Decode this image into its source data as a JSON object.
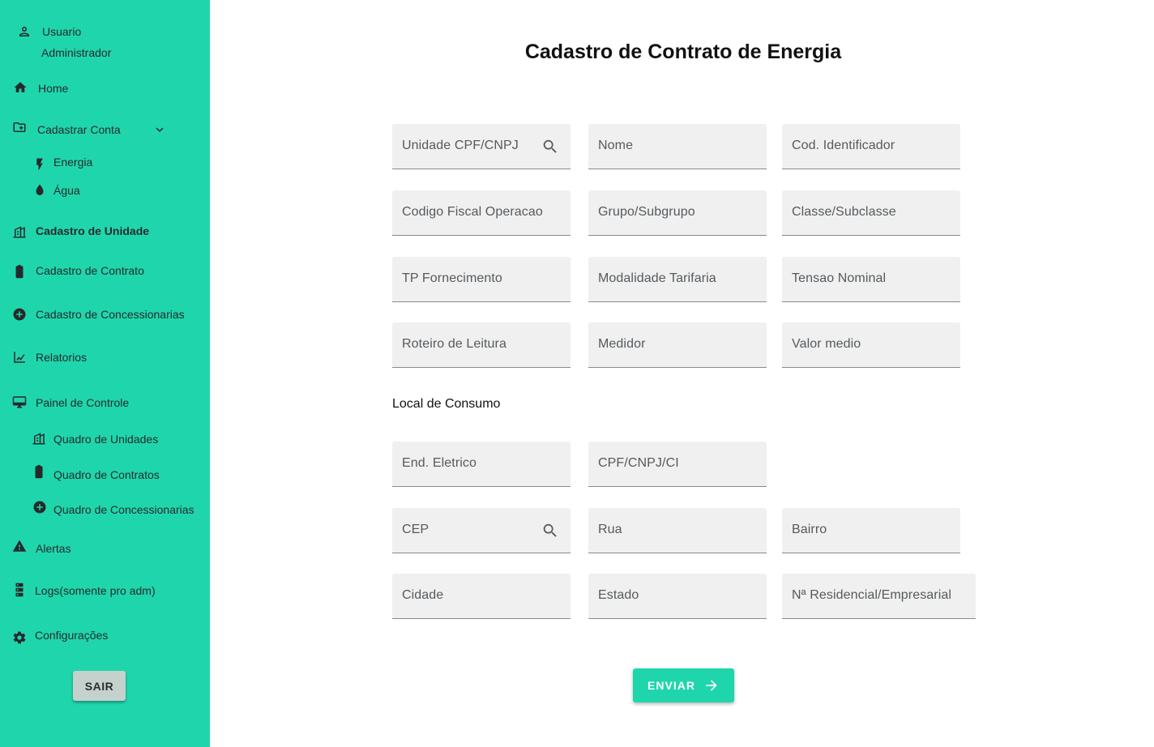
{
  "sidebar": {
    "user": {
      "name": "Usuario",
      "role": "Administrador"
    },
    "home": "Home",
    "cadastrar_conta": "Cadastrar Conta",
    "energia": "Energia",
    "agua": "Água",
    "cadastro_unidade": "Cadastro de Unidade",
    "cadastro_contrato": "Cadastro de Contrato",
    "cadastro_concessionarias": "Cadastro de Concessionarias",
    "relatorios": "Relatorios",
    "painel_controle": "Painel de Controle",
    "quadro_unidades": "Quadro de Unidades",
    "quadro_contratos": "Quadro de Contratos",
    "quadro_concessionarias": "Quadro de Concessionarias",
    "alertas": "Alertas",
    "logs": "Logs(somente pro adm)",
    "configuracoes": "Configurações",
    "sair": "SAIR"
  },
  "main": {
    "title": "Cadastro de Contrato de Energia",
    "fields": {
      "unidade": "Unidade CPF/CNPJ",
      "nome": "Nome",
      "cod_identificador": "Cod. Identificador",
      "codigo_fiscal": "Codigo Fiscal Operacao",
      "grupo": "Grupo/Subgrupo",
      "classe": "Classe/Subclasse",
      "tp_fornecimento": "TP Fornecimento",
      "modalidade": "Modalidade Tarifaria",
      "tensao": "Tensao Nominal",
      "roteiro": "Roteiro de Leitura",
      "medidor": "Medidor",
      "valor_medio": "Valor medio"
    },
    "local_section": "Local de Consumo",
    "local_fields": {
      "end_eletrico": "End. Eletrico",
      "cpf_cnpj_ci": "CPF/CNPJ/CI",
      "cep": "CEP",
      "rua": "Rua",
      "bairro": "Bairro",
      "cidade": "Cidade",
      "estado": "Estado",
      "numero": "Nª Residencial/Empresarial"
    },
    "submit": "ENVIAR"
  },
  "colors": {
    "accent": "#1fd6ac",
    "field_bg": "#f0f0f0"
  },
  "icons": [
    "person-icon",
    "home-icon",
    "folder-add-icon",
    "chevron-down-icon",
    "lightning-icon",
    "water-drop-icon",
    "building-icon",
    "clipboard-icon",
    "add-circle-icon",
    "chart-line-icon",
    "monitor-icon",
    "warning-icon",
    "server-icon",
    "gear-icon",
    "search-icon",
    "arrow-right-icon"
  ]
}
